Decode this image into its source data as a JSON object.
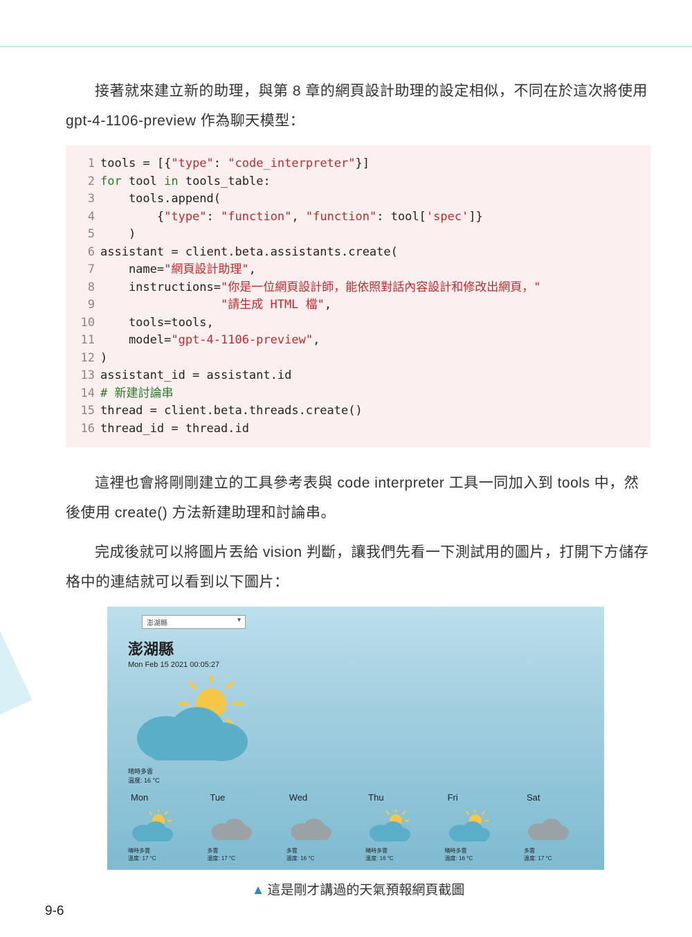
{
  "paragraphs": {
    "p1": "接著就來建立新的助理，與第 8 章的網頁設計助理的設定相似，不同在於這次將使用 gpt-4-1106-preview 作為聊天模型：",
    "p2": "這裡也會將剛剛建立的工具參考表與 code interpreter 工具一同加入到 tools 中，然後使用 create() 方法新建助理和討論串。",
    "p3": "完成後就可以將圖片丟給 vision 判斷，讓我們先看一下測試用的圖片，打開下方儲存格中的連結就可以看到以下圖片："
  },
  "code": {
    "l1_a": "tools = [{",
    "l1_s1": "\"type\"",
    "l1_b": ": ",
    "l1_s2": "\"code_interpreter\"",
    "l1_c": "}]",
    "l2_a": "for",
    "l2_b": " tool ",
    "l2_c": "in",
    "l2_d": " tools_table:",
    "l3": "    tools.append(",
    "l4_a": "        {",
    "l4_s1": "\"type\"",
    "l4_b": ": ",
    "l4_s2": "\"function\"",
    "l4_c": ", ",
    "l4_s3": "\"function\"",
    "l4_d": ": tool[",
    "l4_s4": "'spec'",
    "l4_e": "]}",
    "l5": "    )",
    "l6": "assistant = client.beta.assistants.create(",
    "l7_a": "    name=",
    "l7_s": "\"網頁設計助理\"",
    "l7_b": ",",
    "l8_a": "    instructions=",
    "l8_s": "\"你是一位網頁設計師，能依照對話內容設計和修改出網頁，\"",
    "l9_a": "                 ",
    "l9_s": "\"請生成 HTML 檔\"",
    "l9_b": ",",
    "l10": "    tools=tools,",
    "l11_a": "    model=",
    "l11_s": "\"gpt-4-1106-preview\"",
    "l11_b": ",",
    "l12": ")",
    "l13": "assistant_id = assistant.id",
    "l14": "# 新建討論串",
    "l15": "thread = client.beta.threads.create()",
    "l16": "thread_id = thread.id"
  },
  "weather": {
    "dropdown": "澎湖縣",
    "city": "澎湖縣",
    "date": "Mon Feb 15 2021 00:05:27",
    "today_desc": "晴時多雲",
    "today_temp": "溫度: 16 °C",
    "days": [
      {
        "name": "Mon",
        "desc": "晴時多雲",
        "temp": "溫度: 17 °C",
        "icon": "suncloud"
      },
      {
        "name": "Tue",
        "desc": "多雲",
        "temp": "溫度: 17 °C",
        "icon": "cloud"
      },
      {
        "name": "Wed",
        "desc": "多雲",
        "temp": "溫度: 16 °C",
        "icon": "cloud"
      },
      {
        "name": "Thu",
        "desc": "晴時多雲",
        "temp": "溫度: 16 °C",
        "icon": "suncloud"
      },
      {
        "name": "Fri",
        "desc": "晴時多雲",
        "temp": "溫度: 16 °C",
        "icon": "suncloud"
      },
      {
        "name": "Sat",
        "desc": "多雲",
        "temp": "溫度: 17 °C",
        "icon": "cloud"
      }
    ]
  },
  "caption": "這是剛才講過的天氣預報網頁截圖",
  "page_num": "9-6"
}
